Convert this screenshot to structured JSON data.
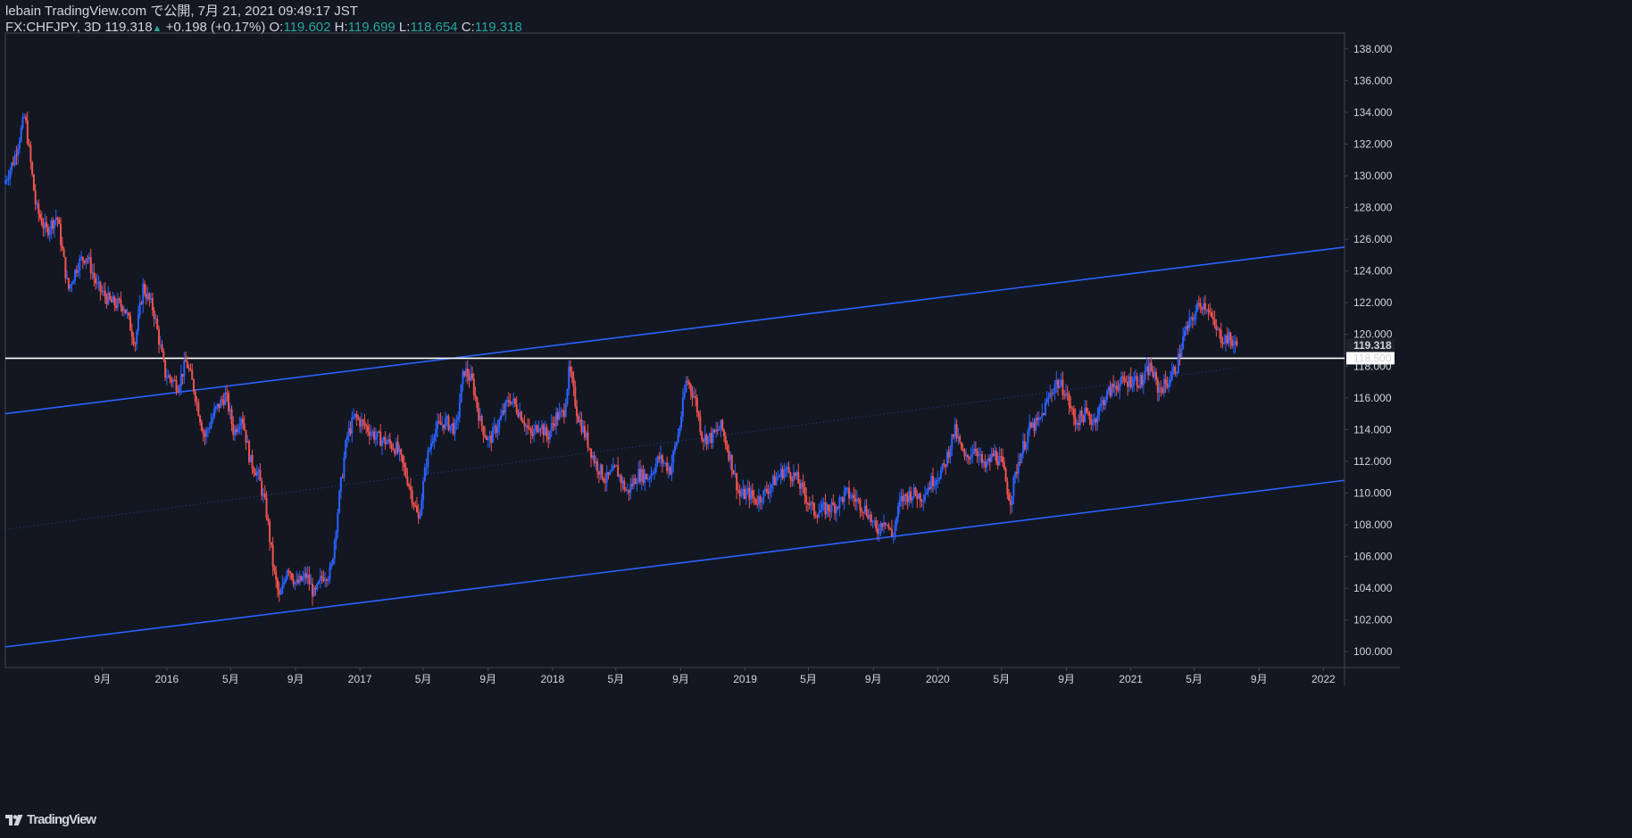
{
  "header": {
    "published": "lebain TradingView.com で公開, 7月 21, 2021 09:49:17 JST",
    "symbol": "FX:CHFJPY, 3D",
    "last": "119.318",
    "arrow": "▲",
    "change": "+0.198 (+0.17%)",
    "o_label": "O:",
    "o_value": "119.602",
    "h_label": "H:",
    "h_value": "119.699",
    "l_label": "L:",
    "l_value": "118.654",
    "c_label": "C:",
    "c_value": "119.318"
  },
  "footer": {
    "brand": "TradingView",
    "logo_icon": "tradingview-logo-icon"
  },
  "colors": {
    "background": "#131722",
    "up": "#2962ff",
    "down": "#ef5350",
    "trendline": "#2962ff",
    "level_line": "#ffffff",
    "text": "#d1d4dc"
  },
  "chart_data": {
    "type": "candlestick",
    "yaxis_ticks": [
      "138.000",
      "136.000",
      "134.000",
      "132.000",
      "130.000",
      "128.000",
      "126.000",
      "124.000",
      "122.000",
      "120.000",
      "118.000",
      "116.000",
      "114.000",
      "112.000",
      "110.000",
      "108.000",
      "106.000",
      "104.000",
      "102.000",
      "100.000"
    ],
    "ylim": [
      99.0,
      139.0
    ],
    "xaxis_ticks": [
      "9月",
      "2016",
      "5月",
      "9月",
      "2017",
      "5月",
      "9月",
      "2018",
      "5月",
      "9月",
      "2019",
      "5月",
      "9月",
      "2020",
      "5月",
      "9月",
      "2021",
      "5月",
      "9月",
      "2022"
    ],
    "x_range": [
      "2015-03-01",
      "2022-02-10"
    ],
    "last_price_label": "119.318",
    "horizontal_level": {
      "value": 118.5,
      "label": "118.500"
    },
    "trend_lines": [
      {
        "name": "upper channel",
        "from": [
          "2015-03-01",
          115.0
        ],
        "to": [
          "2022-02-10",
          125.5
        ]
      },
      {
        "name": "lower channel",
        "from": [
          "2015-03-01",
          100.3
        ],
        "to": [
          "2022-02-10",
          110.8
        ]
      },
      {
        "name": "mid channel (dotted)",
        "from": [
          "2015-03-01",
          107.7
        ],
        "to": [
          "2021-07-21",
          117.9
        ]
      }
    ],
    "price_path": [
      [
        "2015-03-01",
        129.5
      ],
      [
        "2015-03-20",
        131.0
      ],
      [
        "2015-04-10",
        133.8
      ],
      [
        "2015-05-01",
        128.0
      ],
      [
        "2015-05-20",
        126.5
      ],
      [
        "2015-06-10",
        127.5
      ],
      [
        "2015-07-01",
        122.8
      ],
      [
        "2015-07-20",
        124.5
      ],
      [
        "2015-08-05",
        125.0
      ],
      [
        "2015-08-25",
        123.0
      ],
      [
        "2015-09-20",
        122.0
      ],
      [
        "2015-10-15",
        121.8
      ],
      [
        "2015-11-05",
        119.5
      ],
      [
        "2015-11-20",
        123.0
      ],
      [
        "2015-12-10",
        121.5
      ],
      [
        "2016-01-01",
        117.5
      ],
      [
        "2016-01-25",
        116.8
      ],
      [
        "2016-02-10",
        118.3
      ],
      [
        "2016-02-25",
        116.5
      ],
      [
        "2016-03-15",
        113.5
      ],
      [
        "2016-04-05",
        115.2
      ],
      [
        "2016-04-25",
        116.2
      ],
      [
        "2016-05-10",
        113.8
      ],
      [
        "2016-05-25",
        115.0
      ],
      [
        "2016-06-10",
        112.0
      ],
      [
        "2016-06-25",
        111.2
      ],
      [
        "2016-07-10",
        109.0
      ],
      [
        "2016-07-25",
        105.0
      ],
      [
        "2016-08-05",
        103.2
      ],
      [
        "2016-08-20",
        105.5
      ],
      [
        "2016-09-05",
        104.2
      ],
      [
        "2016-09-25",
        104.8
      ],
      [
        "2016-10-10",
        103.5
      ],
      [
        "2016-10-25",
        104.8
      ],
      [
        "2016-11-10",
        105.0
      ],
      [
        "2016-11-25",
        109.5
      ],
      [
        "2016-12-10",
        113.5
      ],
      [
        "2016-12-25",
        114.8
      ],
      [
        "2017-01-15",
        114.2
      ],
      [
        "2017-02-05",
        113.5
      ],
      [
        "2017-02-25",
        113.2
      ],
      [
        "2017-03-15",
        112.8
      ],
      [
        "2017-04-05",
        110.8
      ],
      [
        "2017-04-25",
        108.3
      ],
      [
        "2017-05-10",
        112.0
      ],
      [
        "2017-05-25",
        114.0
      ],
      [
        "2017-06-15",
        114.5
      ],
      [
        "2017-07-05",
        114.0
      ],
      [
        "2017-07-20",
        117.8
      ],
      [
        "2017-08-05",
        117.0
      ],
      [
        "2017-08-20",
        114.5
      ],
      [
        "2017-09-05",
        113.2
      ],
      [
        "2017-09-25",
        114.5
      ],
      [
        "2017-10-15",
        116.0
      ],
      [
        "2017-11-05",
        115.0
      ],
      [
        "2017-11-25",
        113.5
      ],
      [
        "2017-12-10",
        114.5
      ],
      [
        "2017-12-25",
        113.5
      ],
      [
        "2018-01-10",
        114.8
      ],
      [
        "2018-01-25",
        115.0
      ],
      [
        "2018-02-05",
        117.8
      ],
      [
        "2018-02-20",
        115.0
      ],
      [
        "2018-03-05",
        113.8
      ],
      [
        "2018-03-25",
        112.0
      ],
      [
        "2018-04-15",
        110.8
      ],
      [
        "2018-05-05",
        111.5
      ],
      [
        "2018-05-25",
        110.0
      ],
      [
        "2018-06-15",
        111.2
      ],
      [
        "2018-07-05",
        111.0
      ],
      [
        "2018-07-25",
        112.2
      ],
      [
        "2018-08-15",
        111.5
      ],
      [
        "2018-09-01",
        114.0
      ],
      [
        "2018-09-15",
        117.2
      ],
      [
        "2018-10-01",
        116.0
      ],
      [
        "2018-10-15",
        113.5
      ],
      [
        "2018-11-01",
        113.5
      ],
      [
        "2018-11-20",
        114.2
      ],
      [
        "2018-12-10",
        111.8
      ],
      [
        "2018-12-25",
        109.8
      ],
      [
        "2019-01-10",
        110.0
      ],
      [
        "2019-01-25",
        109.5
      ],
      [
        "2019-02-10",
        110.0
      ],
      [
        "2019-03-01",
        110.8
      ],
      [
        "2019-03-20",
        111.5
      ],
      [
        "2019-04-10",
        111.0
      ],
      [
        "2019-04-25",
        110.0
      ],
      [
        "2019-05-15",
        108.8
      ],
      [
        "2019-06-05",
        109.0
      ],
      [
        "2019-06-25",
        109.2
      ],
      [
        "2019-07-15",
        110.0
      ],
      [
        "2019-08-05",
        109.5
      ],
      [
        "2019-08-25",
        108.8
      ],
      [
        "2019-09-10",
        107.5
      ],
      [
        "2019-09-25",
        108.5
      ],
      [
        "2019-10-10",
        107.2
      ],
      [
        "2019-10-25",
        109.5
      ],
      [
        "2019-11-15",
        110.0
      ],
      [
        "2019-12-05",
        109.8
      ],
      [
        "2019-12-25",
        110.8
      ],
      [
        "2020-01-15",
        111.5
      ],
      [
        "2020-02-05",
        114.0
      ],
      [
        "2020-02-25",
        112.0
      ],
      [
        "2020-03-15",
        113.0
      ],
      [
        "2020-04-01",
        111.5
      ],
      [
        "2020-04-20",
        112.5
      ],
      [
        "2020-05-05",
        111.8
      ],
      [
        "2020-05-20",
        109.5
      ],
      [
        "2020-06-05",
        112.0
      ],
      [
        "2020-06-25",
        114.0
      ],
      [
        "2020-07-15",
        114.5
      ],
      [
        "2020-08-01",
        116.0
      ],
      [
        "2020-08-15",
        117.0
      ],
      [
        "2020-09-01",
        116.5
      ],
      [
        "2020-09-20",
        114.5
      ],
      [
        "2020-10-10",
        115.0
      ],
      [
        "2020-10-25",
        114.5
      ],
      [
        "2020-11-15",
        116.0
      ],
      [
        "2020-12-05",
        116.8
      ],
      [
        "2020-12-25",
        117.0
      ],
      [
        "2021-01-10",
        117.2
      ],
      [
        "2021-01-25",
        117.0
      ],
      [
        "2021-02-10",
        118.0
      ],
      [
        "2021-02-25",
        116.5
      ],
      [
        "2021-03-15",
        117.0
      ],
      [
        "2021-04-01",
        118.0
      ],
      [
        "2021-04-15",
        120.0
      ],
      [
        "2021-05-01",
        121.0
      ],
      [
        "2021-05-15",
        122.0
      ],
      [
        "2021-05-30",
        121.8
      ],
      [
        "2021-06-10",
        120.5
      ],
      [
        "2021-06-25",
        119.8
      ],
      [
        "2021-07-10",
        119.7
      ],
      [
        "2021-07-21",
        119.3
      ]
    ]
  }
}
